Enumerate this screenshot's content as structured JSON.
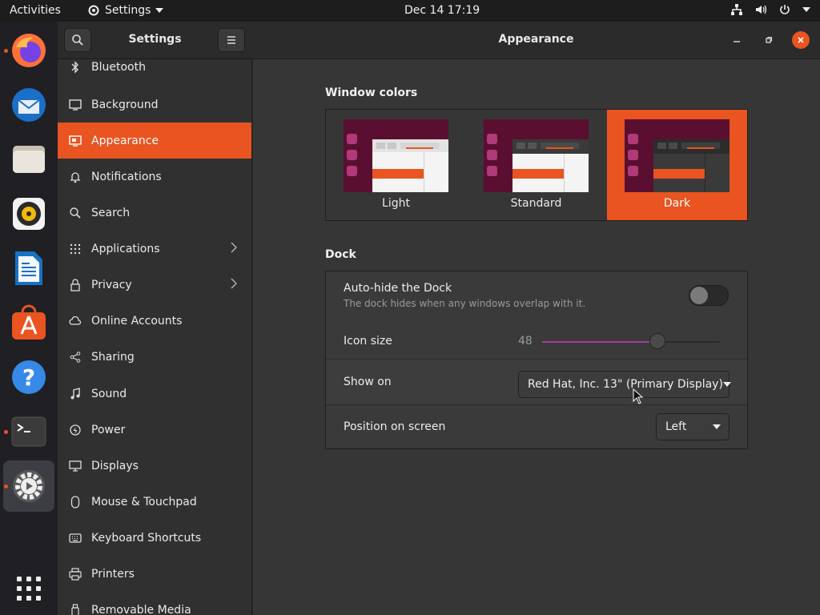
{
  "topbar": {
    "activities": "Activities",
    "app_menu": "Settings",
    "clock": "Dec 14  17:19"
  },
  "dock": {
    "apps": [
      {
        "name": "firefox-icon",
        "running": true
      },
      {
        "name": "thunderbird-icon",
        "running": false
      },
      {
        "name": "files-icon",
        "running": false
      },
      {
        "name": "rhythmbox-icon",
        "running": false
      },
      {
        "name": "libreoffice-writer-icon",
        "running": false
      },
      {
        "name": "ubuntu-software-icon",
        "running": false
      },
      {
        "name": "help-icon",
        "running": false
      },
      {
        "name": "terminal-icon",
        "running": true
      },
      {
        "name": "settings-icon",
        "running": true,
        "active": true
      },
      {
        "name": "show-apps-icon",
        "running": false
      }
    ]
  },
  "sidebar": {
    "title": "Settings",
    "items": [
      {
        "label": "Bluetooth",
        "icon": "bluetooth-icon"
      },
      {
        "label": "Background",
        "icon": "background-icon"
      },
      {
        "label": "Appearance",
        "icon": "appearance-icon",
        "selected": true
      },
      {
        "label": "Notifications",
        "icon": "bell-icon"
      },
      {
        "label": "Search",
        "icon": "search-icon"
      },
      {
        "label": "Applications",
        "icon": "grid-icon",
        "chevron": true
      },
      {
        "label": "Privacy",
        "icon": "lock-icon",
        "chevron": true
      },
      {
        "label": "Online Accounts",
        "icon": "cloud-icon"
      },
      {
        "label": "Sharing",
        "icon": "share-icon"
      },
      {
        "label": "Sound",
        "icon": "music-note-icon"
      },
      {
        "label": "Power",
        "icon": "power-icon"
      },
      {
        "label": "Displays",
        "icon": "display-icon"
      },
      {
        "label": "Mouse & Touchpad",
        "icon": "mouse-icon"
      },
      {
        "label": "Keyboard Shortcuts",
        "icon": "keyboard-icon"
      },
      {
        "label": "Printers",
        "icon": "printer-icon"
      },
      {
        "label": "Removable Media",
        "icon": "removable-media-icon"
      }
    ]
  },
  "content": {
    "title": "Appearance",
    "window_colors": {
      "heading": "Window colors",
      "options": [
        {
          "label": "Light",
          "selected": false
        },
        {
          "label": "Standard",
          "selected": false
        },
        {
          "label": "Dark",
          "selected": true
        }
      ]
    },
    "dock": {
      "heading": "Dock",
      "autohide_label": "Auto-hide the Dock",
      "autohide_sub": "The dock hides when any windows overlap with it.",
      "autohide_on": false,
      "icon_size_label": "Icon size",
      "icon_size_value": "48",
      "icon_size_fraction": 0.65,
      "show_on_label": "Show on",
      "show_on_value": "Red Hat, Inc. 13\" (Primary Display)",
      "position_label": "Position on screen",
      "position_value": "Left"
    }
  },
  "colors": {
    "accent": "#e95420",
    "aubergine": "#5e0f3a"
  }
}
